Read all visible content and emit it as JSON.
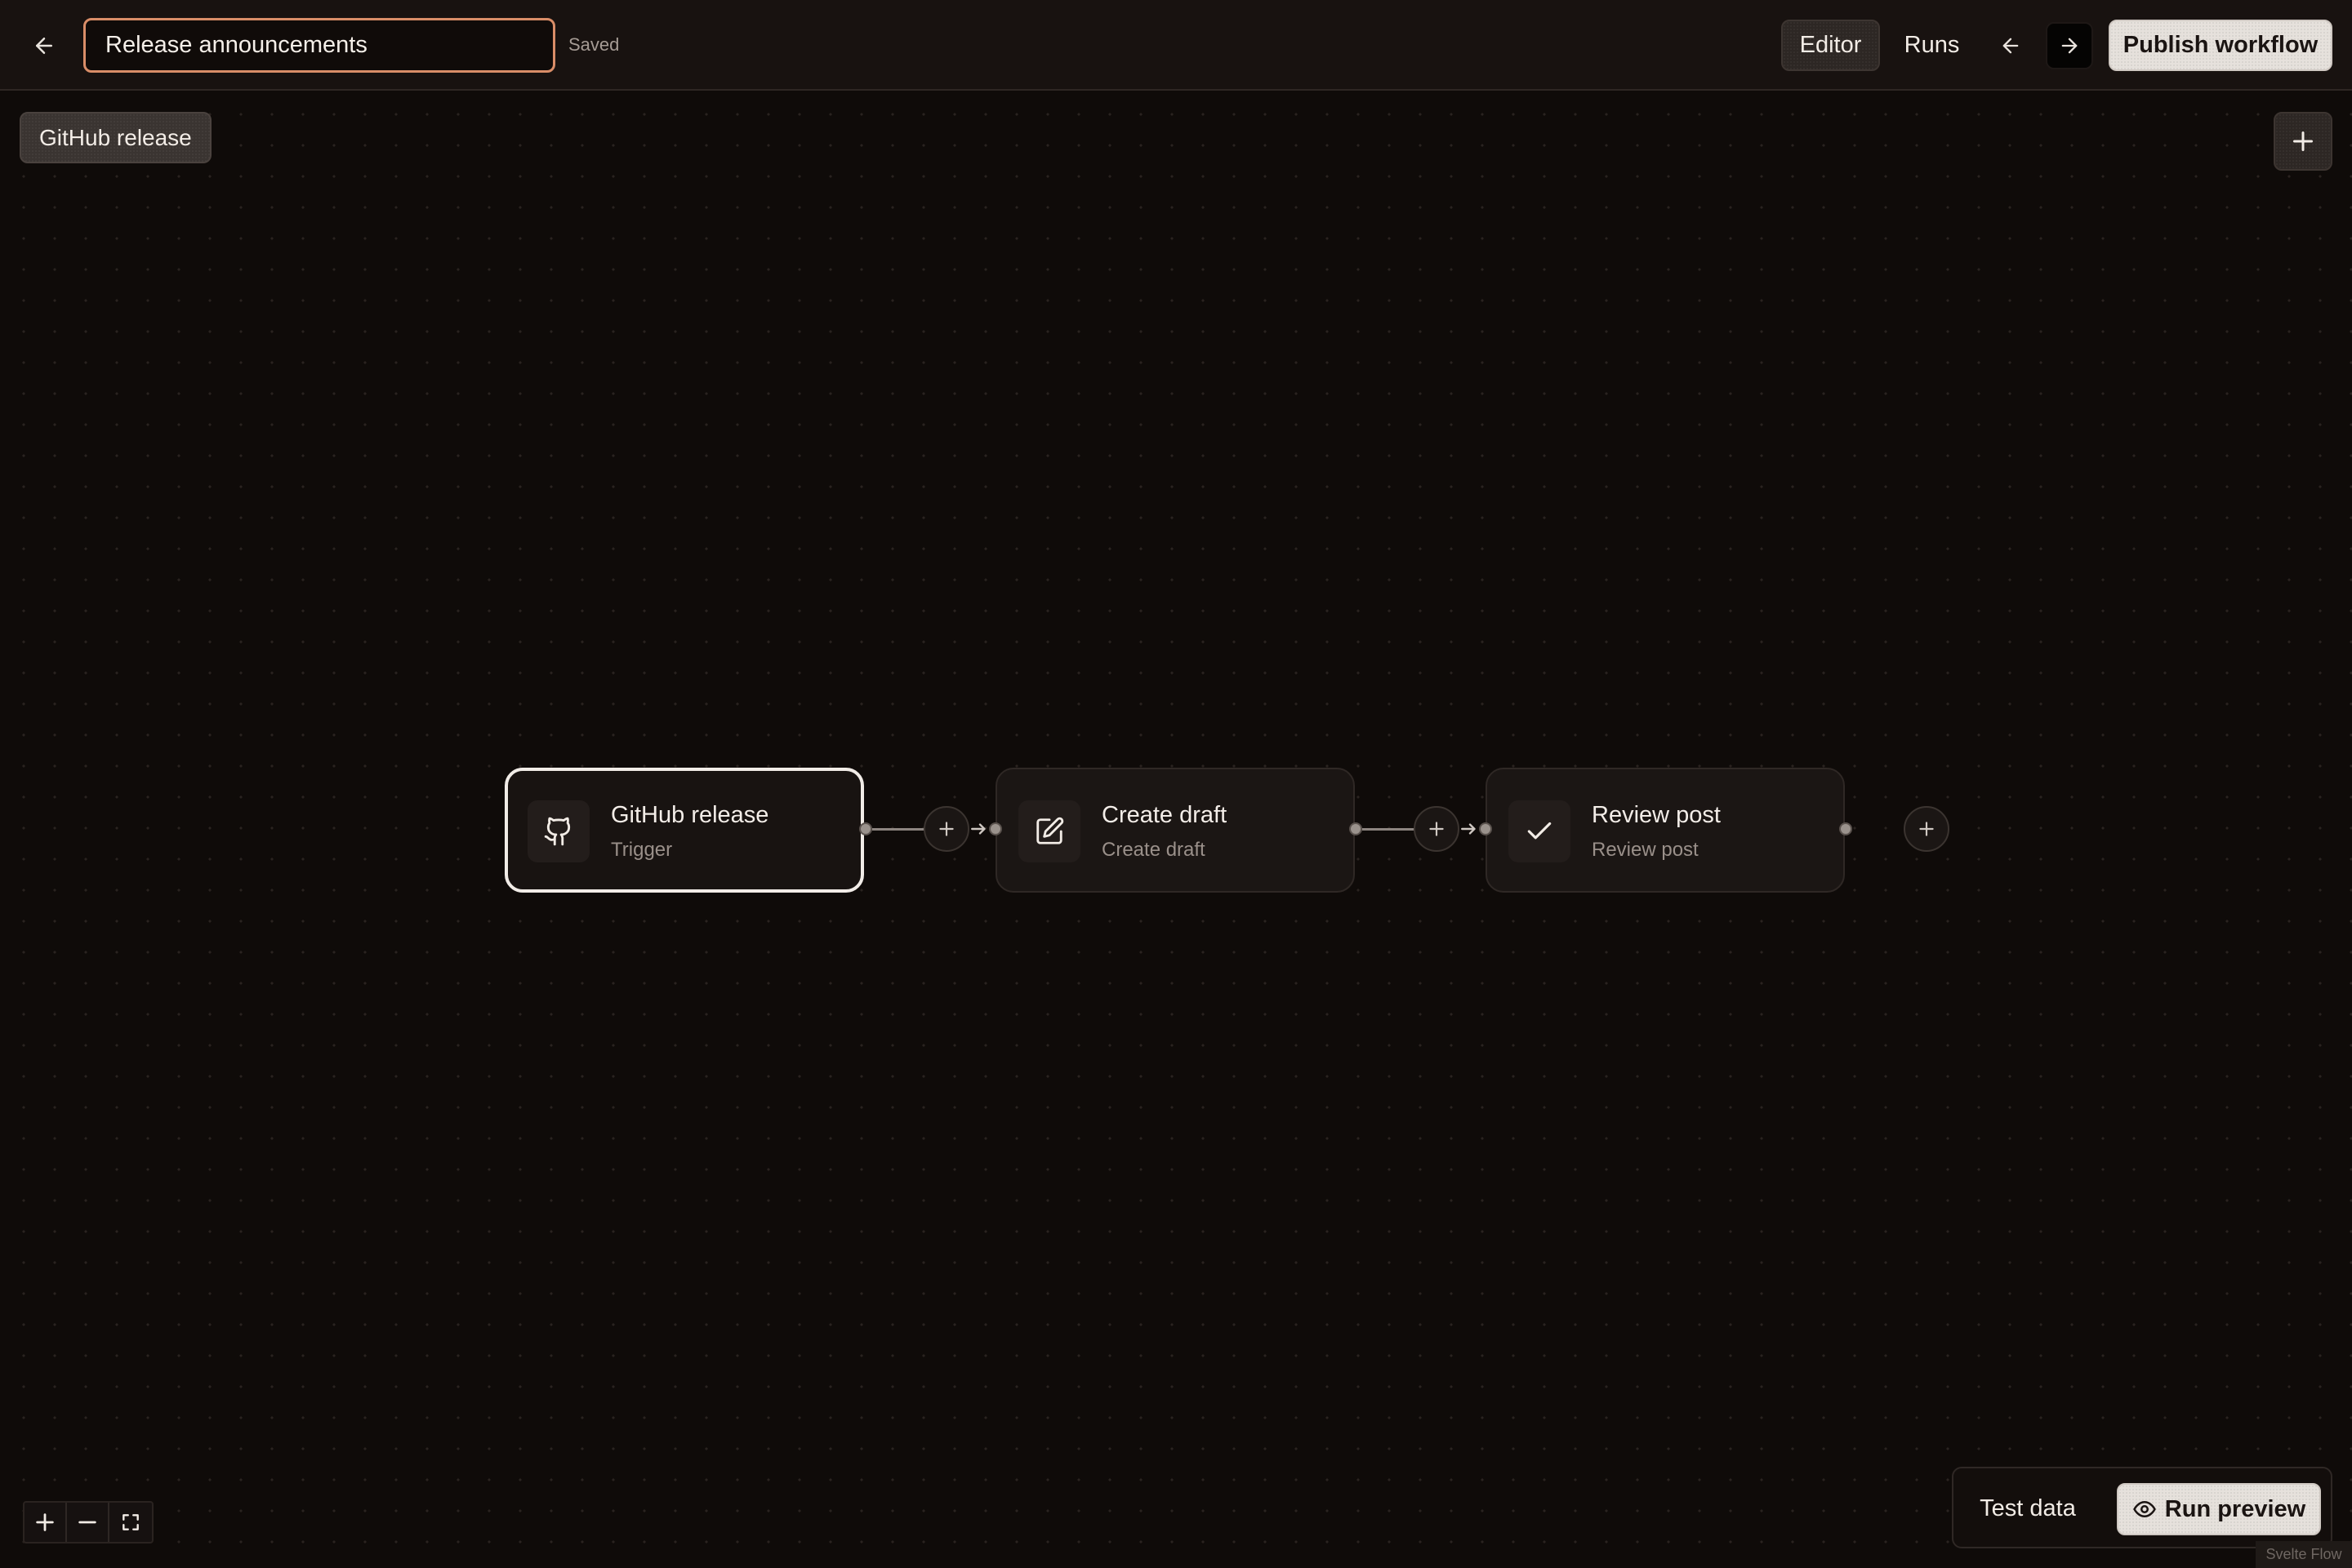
{
  "header": {
    "workflow_name": "Release announcements",
    "save_status": "Saved",
    "tabs": [
      {
        "label": "Editor",
        "active": true
      },
      {
        "label": "Runs",
        "active": false
      }
    ],
    "publish_label": "Publish workflow",
    "back_icon": "arrow-left-icon",
    "undo_icon": "arrow-left-icon",
    "redo_icon": "arrow-right-icon"
  },
  "canvas": {
    "trigger_chip_label": "GitHub release",
    "add_node_icon": "plus-icon",
    "nodes": [
      {
        "title": "GitHub release",
        "subtitle": "Trigger",
        "icon": "github-icon",
        "selected": true
      },
      {
        "title": "Create draft",
        "subtitle": "Create draft",
        "icon": "edit-icon",
        "selected": false
      },
      {
        "title": "Review post",
        "subtitle": "Review post",
        "icon": "check-icon",
        "selected": false
      }
    ],
    "controls": {
      "zoom_in_icon": "plus-icon",
      "zoom_out_icon": "minus-icon",
      "fit_view_icon": "fit-view-icon"
    },
    "attribution": "Svelte Flow"
  },
  "preview": {
    "test_data_label": "Test data",
    "run_preview_label": "Run preview",
    "run_preview_icon": "eye-icon"
  },
  "colors": {
    "background": "#0f0b09",
    "topbar": "#181210",
    "input_focus_border": "#d98d68",
    "primary_button": "#e6e1dc",
    "node_surface": "#1b1614",
    "selected_border": "#f1ece7"
  }
}
